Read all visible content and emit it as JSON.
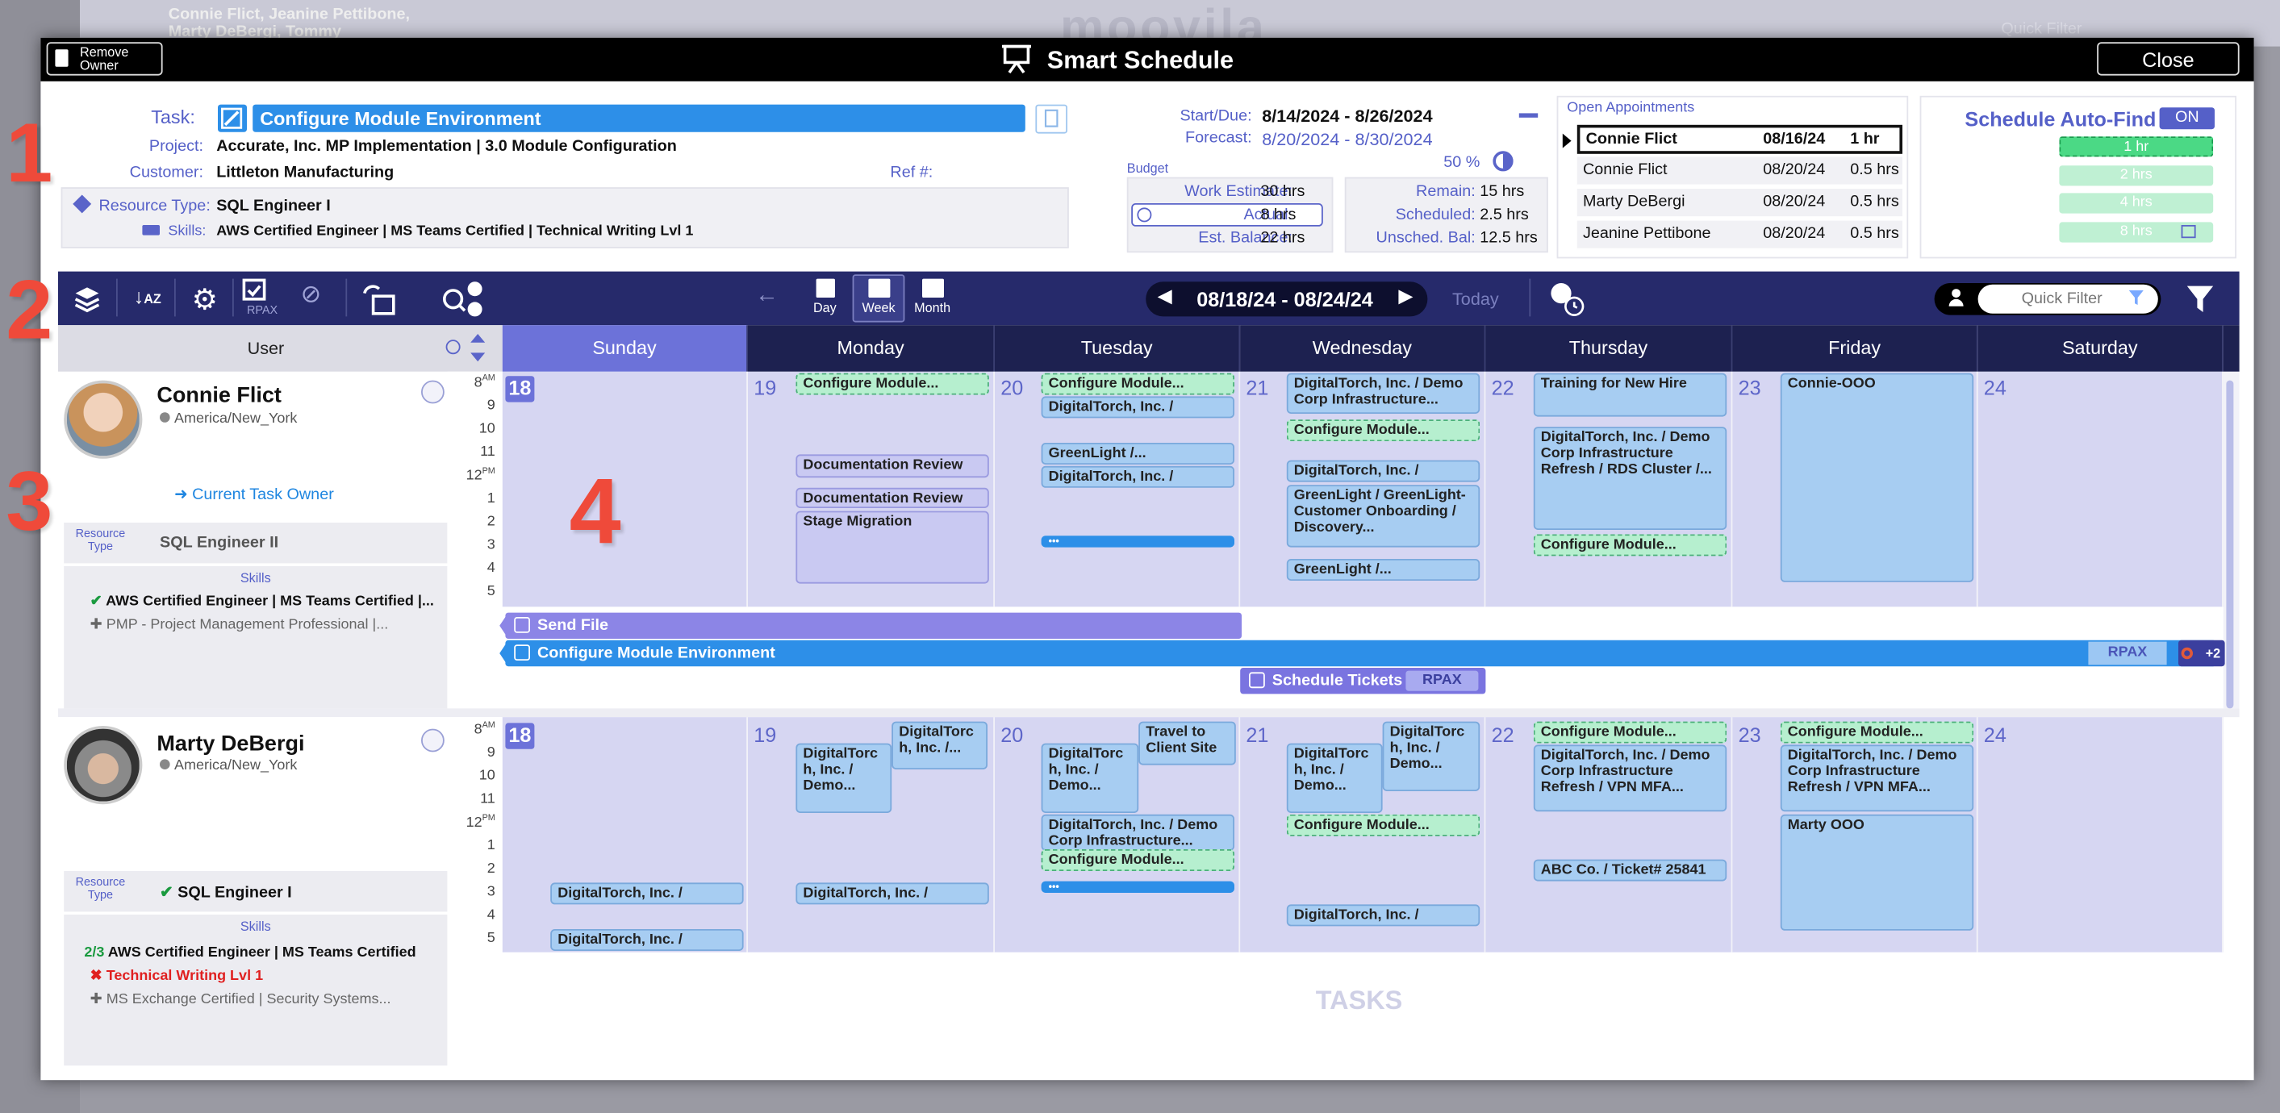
{
  "background": {
    "names_line1": "Connie  Flict,  Jeanine  Pettibone,",
    "names_line2": "Marty DeBergi,  Tommy",
    "logo": "moovila",
    "quick_filter": "Quick Filter",
    "tasks_label": "TASKS"
  },
  "titlebar": {
    "title": "Smart Schedule",
    "remove_owner_line1": "Remove",
    "remove_owner_line2": "Owner",
    "close_label": "Close"
  },
  "task": {
    "task_label": "Task:",
    "task_name": "Configure Module Environment",
    "project_label": "Project:",
    "project_value": "Accurate, Inc. MP Implementation  |  3.0 Module Configuration",
    "customer_label": "Customer:",
    "customer_value": "Littleton Manufacturing",
    "ref_label": "Ref #:",
    "resource_type_label": "Resource Type:",
    "resource_type_value": "SQL Engineer I",
    "skills_label": "Skills:",
    "skills_value": "AWS Certified Engineer | MS Teams Certified | Technical Writing Lvl 1"
  },
  "dates": {
    "start_due_label": "Start/Due:",
    "start_due_value": "8/14/2024  -  8/26/2024",
    "forecast_label": "Forecast:",
    "forecast_value": "8/20/2024  -  8/30/2024",
    "percent": "50 %",
    "budget_label": "Budget",
    "work_estimate_label": "Work Estimate:",
    "work_estimate_value": "30 hrs",
    "actual_label": "Actual:",
    "actual_value": "8 hrs",
    "est_balance_label": "Est. Balance:",
    "est_balance_value": "22 hrs",
    "remain_label": "Remain:",
    "remain_value": "15 hrs",
    "scheduled_label": "Scheduled:",
    "scheduled_value": "2.5 hrs",
    "unsched_label": "Unsched. Bal:",
    "unsched_value": "12.5 hrs"
  },
  "open_appointments": {
    "title": "Open Appointments",
    "rows": [
      {
        "name": "Connie  Flict",
        "date": "08/16/24",
        "dur": "1 hr"
      },
      {
        "name": "Connie  Flict",
        "date": "08/20/24",
        "dur": "0.5 hrs"
      },
      {
        "name": "Marty DeBergi",
        "date": "08/20/24",
        "dur": "0.5 hrs"
      },
      {
        "name": "Jeanine  Pettibone",
        "date": "08/20/24",
        "dur": "0.5 hrs"
      }
    ]
  },
  "autofind": {
    "title": "Schedule Auto-Find",
    "toggle": "ON",
    "options": [
      "1 hr",
      "2 hrs",
      "4 hrs",
      "8 hrs"
    ]
  },
  "toolbar": {
    "rpax_label": "RPAX",
    "day_label": "Day",
    "week_label": "Week",
    "month_label": "Month",
    "date_range": "08/18/24  -  08/24/24",
    "today_label": "Today",
    "quick_filter_placeholder": "Quick Filter"
  },
  "columns": {
    "user": "User",
    "days": [
      "Sunday",
      "Monday",
      "Tuesday",
      "Wednesday",
      "Thursday",
      "Friday",
      "Saturday"
    ],
    "day_numbers": [
      "18",
      "19",
      "20",
      "21",
      "22",
      "23",
      "24"
    ]
  },
  "hours": [
    "8",
    "9",
    "10",
    "11",
    "12",
    "1",
    "2",
    "3",
    "4",
    "5"
  ],
  "am_label": "AM",
  "pm_label": "PM",
  "users": {
    "connie": {
      "name": "Connie  Flict",
      "tz": "America/New_York",
      "owner_label": "Current Task Owner",
      "resource_type_label_1": "Resource",
      "resource_type_label_2": "Type",
      "resource_type_value": "SQL Engineer II",
      "skills_label": "Skills",
      "skill_match": "AWS Certified Engineer | MS Teams Certified |...",
      "skill_other": "PMP - Project Management Professional |..."
    },
    "marty": {
      "name": "Marty DeBergi",
      "tz": "America/New_York",
      "resource_type_label_1": "Resource",
      "resource_type_label_2": "Type",
      "resource_type_value": "SQL Engineer I",
      "skills_label": "Skills",
      "skill_count": "2/3",
      "skill_match": "AWS Certified Engineer | MS Teams Certified",
      "skill_missing": "Technical Writing Lvl 1",
      "skill_other": "MS Exchange Certified | Security Systems..."
    }
  },
  "events": {
    "configure_module": "Configure Module...",
    "digitaltorch_demo": "DigitalTorch, Inc. / Demo...",
    "digitaltorch_corp": "DigitalTorch, Inc. / Demo Corp Infrastructure...",
    "documentation_review": "Documentation Review",
    "stage_migration": "Stage Migration",
    "greenlight": "GreenLight /...",
    "greenlight_long": "GreenLight / GreenLight-Customer Onboarding / Discovery...",
    "training": "Training for New Hire",
    "rds_cluster": "DigitalTorch, Inc. / Demo Corp Infrastructure Refresh / RDS Cluster /...",
    "connie_ooo": "Connie-OOO",
    "dots": "•••",
    "dt_short": "DigitalTorc h, Inc. / Demo...",
    "dt_short2": "DigitalTorc h, Inc. /...",
    "travel": "Travel to Client Site",
    "vpn_mfa": "DigitalTorch, Inc. / Demo Corp Infrastructure Refresh / VPN MFA...",
    "abc_ticket": "ABC Co. / Ticket# 25841 -...",
    "marty_ooo": "Marty OOO"
  },
  "bars": {
    "send_file": "Send File",
    "configure_env": "Configure Module Environment",
    "rpax_tag": "RPAX",
    "plus_count": "+2",
    "schedule_tickets": "Schedule Tickets Ba",
    "rpax_overlay": "RPAX"
  },
  "annotations": [
    "1",
    "2",
    "3",
    "4"
  ],
  "colors": {
    "toolbar": "#262a6b",
    "task_blue": "#2d8fe8",
    "calendar_lavender": "#d6d6f2",
    "event_blue": "#a7cdf2",
    "event_green": "#b6efcf",
    "annotation_red": "#ef4a3a"
  }
}
